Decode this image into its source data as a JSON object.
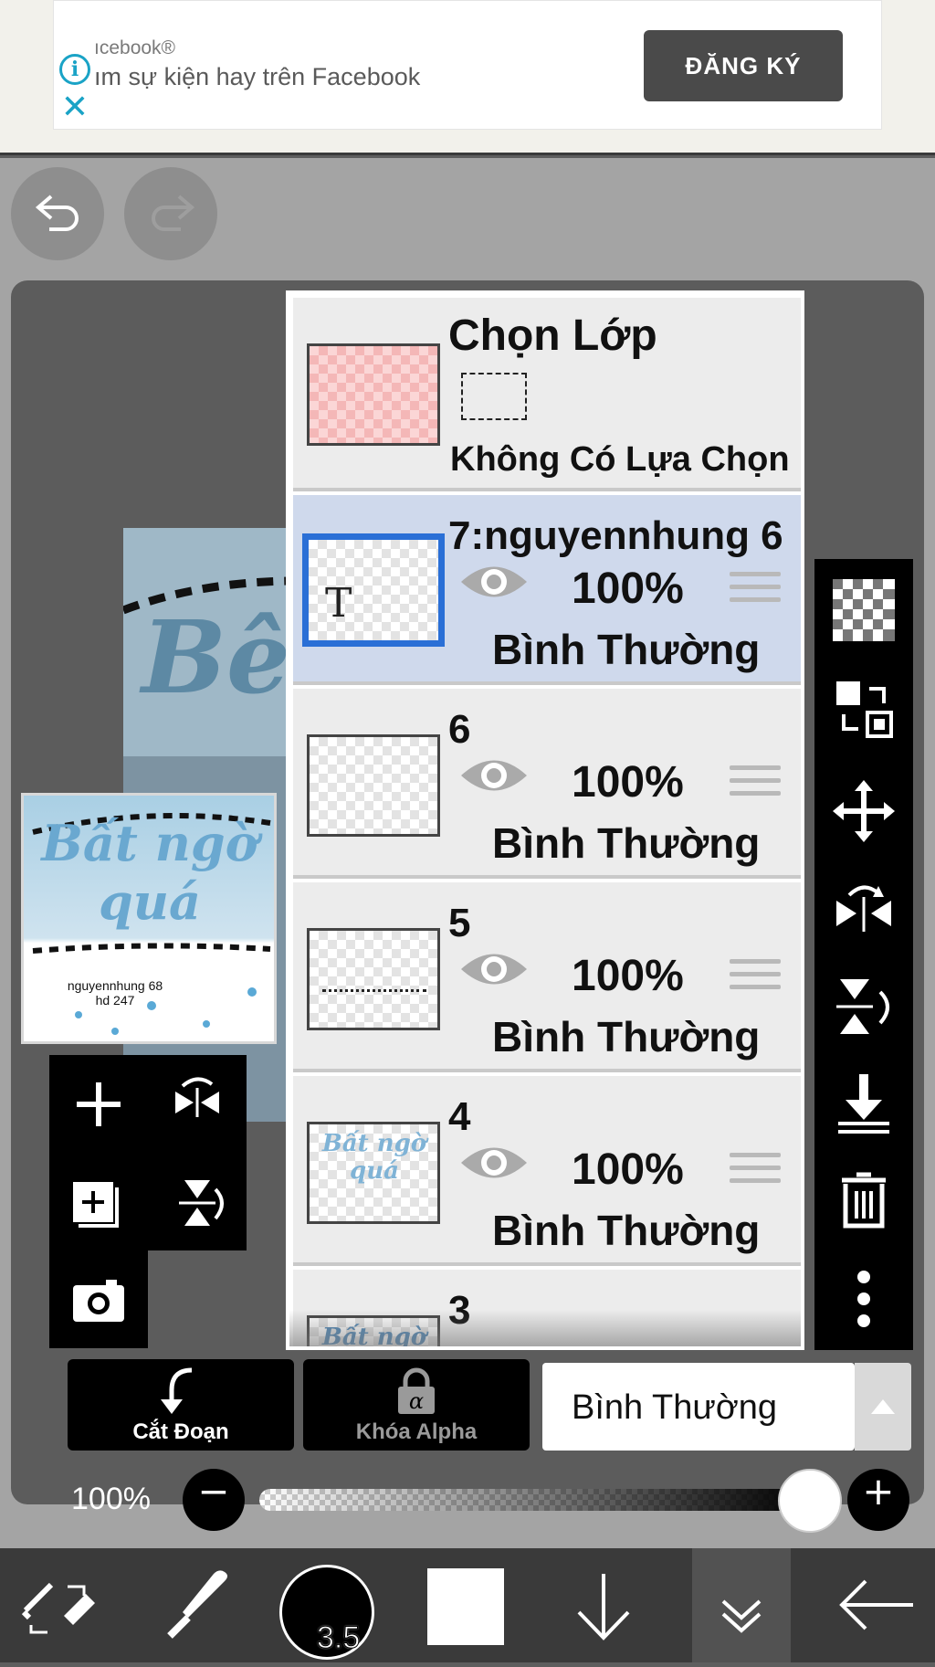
{
  "ad": {
    "brand": "ıcebook®",
    "text": "ım sự kiện hay trên Facebook",
    "cta": "ĐĂNG KÝ"
  },
  "layers_panel": {
    "selection": {
      "title": "Chọn Lớp",
      "status": "Không Có Lựa Chọn"
    },
    "layers": [
      {
        "name": "7:nguyennhung 6",
        "opacity": "100%",
        "blend": "Bình Thường",
        "selected": true
      },
      {
        "name": "6",
        "opacity": "100%",
        "blend": "Bình Thường",
        "selected": false
      },
      {
        "name": "5",
        "opacity": "100%",
        "blend": "Bình Thường",
        "selected": false
      },
      {
        "name": "4",
        "opacity": "100%",
        "blend": "Bình Thường",
        "selected": false
      },
      {
        "name": "3",
        "opacity": "",
        "blend": "",
        "selected": false
      }
    ]
  },
  "preview": {
    "title": "Bất ngờ quá",
    "caption_line1": "nguyennhung 68",
    "caption_line2": "hd 247"
  },
  "bottom_controls": {
    "clip_label": "Cắt Đoạn",
    "alpha_lock_label": "Khóa Alpha",
    "blend_mode": "Bình Thường",
    "opacity_label": "100%",
    "opacity_value": 1.0
  },
  "toolbar": {
    "brush_size": "3.5"
  },
  "colors": {
    "accent_blue": "#2a6fd6",
    "selected_row": "#cfd9ec",
    "ad_accent": "#1aa3c6"
  }
}
